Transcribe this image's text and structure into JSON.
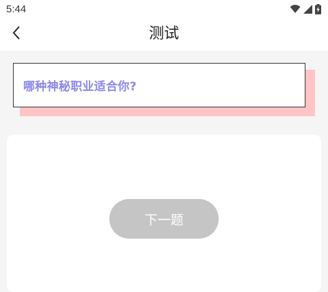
{
  "status_bar": {
    "time": "5:44",
    "icons": [
      "wifi-icon",
      "signal-icon",
      "battery-charging-icon"
    ]
  },
  "nav": {
    "back_icon": "chevron-left-icon",
    "title": "测试"
  },
  "question": {
    "text": "哪种神秘职业适合你?"
  },
  "actions": {
    "next_label": "下一题"
  },
  "colors": {
    "question_text": "#8c88e6",
    "card_shadow": "#ffc4c4",
    "button_disabled": "#c5c5c5",
    "page_background": "#f5f5f5"
  }
}
